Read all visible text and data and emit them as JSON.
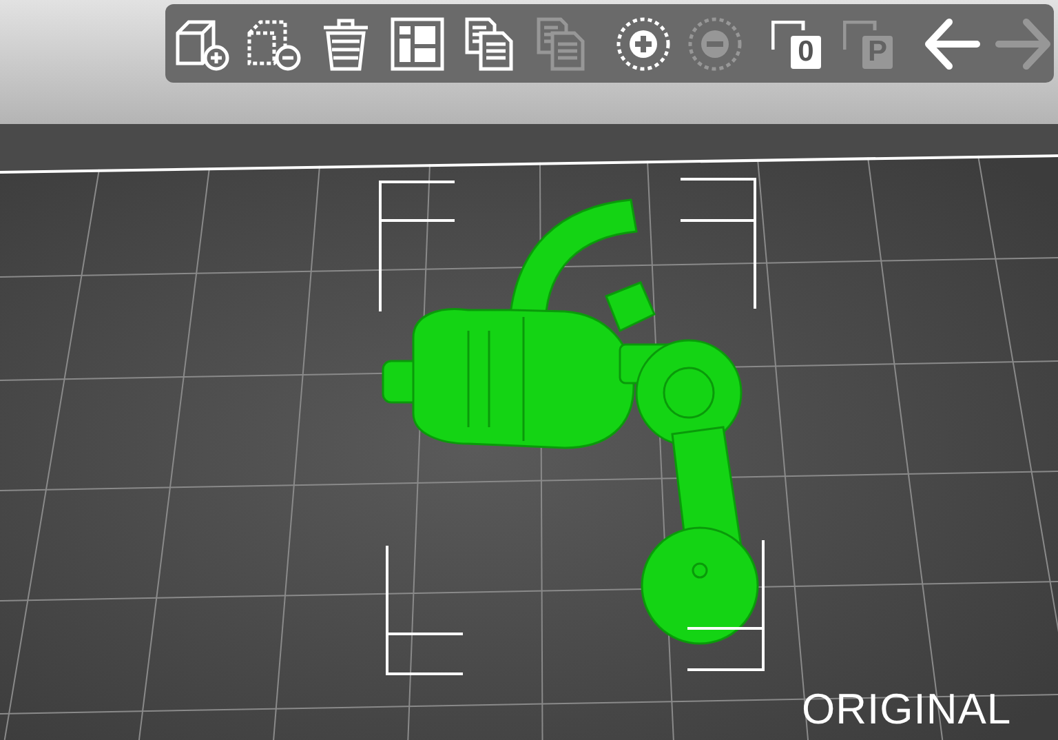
{
  "toolbar": {
    "tools": [
      {
        "kind": "add",
        "disabled": false
      },
      {
        "kind": "delete",
        "disabled": false
      },
      {
        "kind": "delete_all",
        "disabled": false
      },
      {
        "kind": "arrange",
        "disabled": false
      },
      {
        "kind": "copy",
        "disabled": false
      },
      {
        "kind": "paste",
        "disabled": true
      },
      {
        "kind": "more",
        "disabled": false
      },
      {
        "kind": "fewer",
        "disabled": true
      },
      {
        "kind": "split_objects",
        "label": "0",
        "disabled": false
      },
      {
        "kind": "split_parts",
        "label": "P",
        "disabled": true
      },
      {
        "kind": "undo",
        "disabled": false
      },
      {
        "kind": "redo",
        "disabled": true
      }
    ]
  },
  "bed": {
    "logo": "ORIGINAL"
  }
}
